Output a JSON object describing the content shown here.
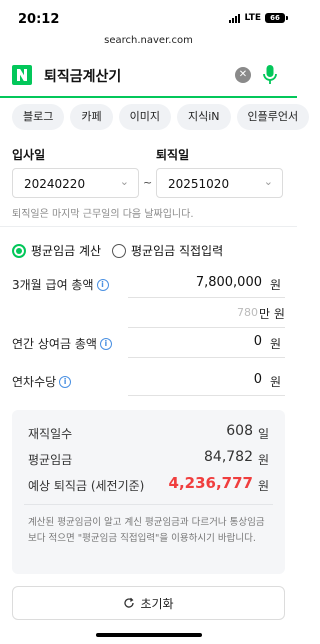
{
  "status_bar": {
    "time": "20:12",
    "network": "LTE",
    "battery": "66"
  },
  "browser": {
    "url": "search.naver.com"
  },
  "search": {
    "query": "퇴직금계산기",
    "clear_icon": "clear-icon",
    "voice_icon": "mic-icon"
  },
  "tabs": [
    "블로그",
    "카페",
    "이미지",
    "지식iN",
    "인플루언서"
  ],
  "dates": {
    "start_label": "입사일",
    "start_value": "20240220",
    "end_label": "퇴직일",
    "end_value": "20251020",
    "separator": "~",
    "note": "퇴직일은 마지막 근무일의 다음 날짜입니다."
  },
  "mode": {
    "option1": "평균임금 계산",
    "option2": "평균임금 직접입력",
    "selected": "option1"
  },
  "form": {
    "salary_label": "3개월 급여 총액",
    "salary_value": "7,800,000",
    "salary_unit": "원",
    "salary_hint_value": "780",
    "salary_hint_unit": "만 원",
    "bonus_label": "연간 상여금 총액",
    "bonus_value": "0",
    "bonus_unit": "원",
    "leave_label": "연차수당",
    "leave_value": "0",
    "leave_unit": "원"
  },
  "result": {
    "days_label": "재직일수",
    "days_value": "608",
    "days_unit": "일",
    "avg_label": "평균임금",
    "avg_value": "84,782",
    "avg_unit": "원",
    "severance_label": "예상 퇴직금 (세전기준)",
    "severance_value": "4,236,777",
    "severance_unit": "원",
    "note": "계산된 평균임금이 알고 계신 평균임금과 다르거나 통상임금보다 적으면 \"평균임금 직접입력\"을 이용하시기 바랍니다."
  },
  "reset_label": "초기화",
  "colors": {
    "accent": "#03c75a",
    "highlight": "#f03e3e",
    "info": "#4a90e2"
  }
}
